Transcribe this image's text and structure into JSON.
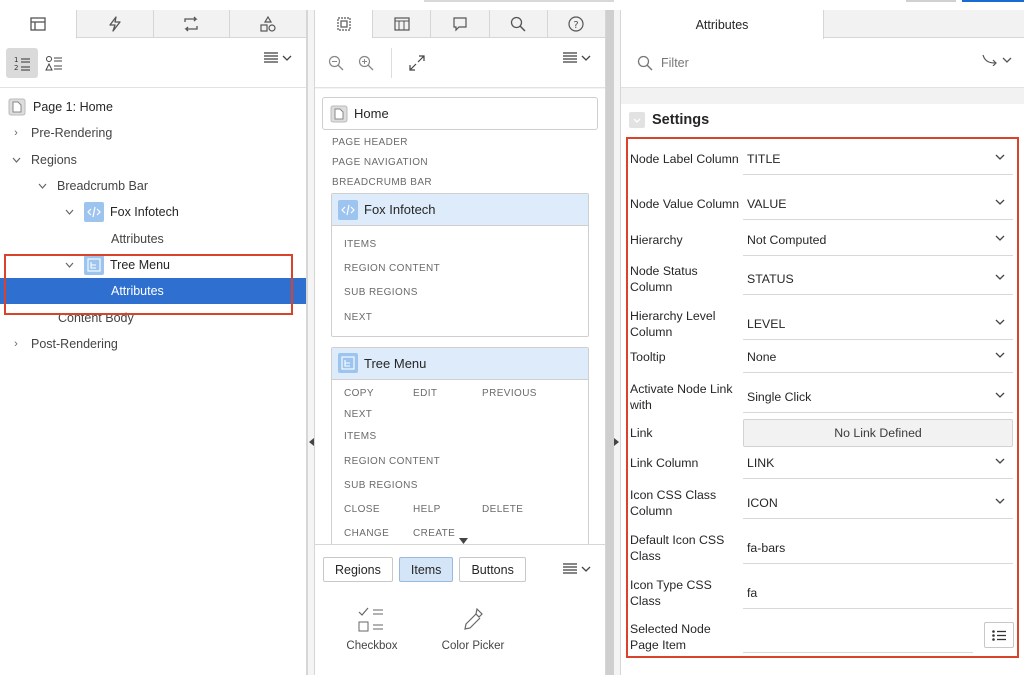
{
  "left": {
    "tree": [
      {
        "label": "Page 1: Home",
        "level": 0,
        "icon": "page-icon"
      },
      {
        "label": "Pre-Rendering",
        "level": 0,
        "expand": "collapsed"
      },
      {
        "label": "Regions",
        "level": 0,
        "expand": "expanded"
      },
      {
        "label": "Breadcrumb Bar",
        "level": 1,
        "expand": "expanded"
      },
      {
        "label": "Fox Infotech",
        "level": 2,
        "expand": "expanded",
        "icon": "code-region-icon"
      },
      {
        "label": "Attributes",
        "level": 3
      },
      {
        "label": "Tree Menu",
        "level": 2,
        "expand": "expanded",
        "icon": "tree-region-icon"
      },
      {
        "label": "Attributes",
        "level": 3,
        "selected": true
      },
      {
        "label": "Content Body",
        "level": 1
      },
      {
        "label": "Post-Rendering",
        "level": 0,
        "expand": "collapsed"
      }
    ]
  },
  "middle": {
    "home_label": "Home",
    "page_sections": [
      "PAGE HEADER",
      "PAGE NAVIGATION",
      "BREADCRUMB BAR"
    ],
    "region1": {
      "title": "Fox Infotech",
      "items": [
        "ITEMS",
        "REGION CONTENT",
        "SUB REGIONS",
        "NEXT"
      ]
    },
    "region2": {
      "title": "Tree Menu",
      "row1": [
        "COPY",
        "EDIT",
        "PREVIOUS"
      ],
      "items": [
        "NEXT",
        "ITEMS",
        "REGION CONTENT",
        "SUB REGIONS"
      ],
      "row2": [
        "CLOSE",
        "HELP",
        "DELETE"
      ],
      "row3": [
        "CHANGE",
        "CREATE"
      ]
    },
    "gallery_tabs": [
      "Regions",
      "Items",
      "Buttons"
    ],
    "gallery_selected": "Items",
    "gallery_items": [
      "Checkbox",
      "Color Picker"
    ]
  },
  "right": {
    "tab": "Attributes",
    "filter_placeholder": "Filter",
    "section": "Settings",
    "props": [
      {
        "label": "Node Label Column",
        "value": "TITLE",
        "type": "select"
      },
      {
        "label": "Node Value Column",
        "value": "VALUE",
        "type": "select"
      },
      {
        "label": "Hierarchy",
        "value": "Not Computed",
        "type": "select"
      },
      {
        "label": "Node Status Column",
        "value": "STATUS",
        "type": "select"
      },
      {
        "label": "Hierarchy Level Column",
        "value": "LEVEL",
        "type": "select"
      },
      {
        "label": "Tooltip",
        "value": "None",
        "type": "select"
      },
      {
        "label": "Activate Node Link with",
        "value": "Single Click",
        "type": "select"
      },
      {
        "label": "Link",
        "value": "No Link Defined",
        "type": "link"
      },
      {
        "label": "Link Column",
        "value": "LINK",
        "type": "select"
      },
      {
        "label": "Icon CSS Class Column",
        "value": "ICON",
        "type": "select"
      },
      {
        "label": "Default Icon CSS Class",
        "value": "fa-bars",
        "type": "text"
      },
      {
        "label": "Icon Type CSS Class",
        "value": "fa",
        "type": "text"
      },
      {
        "label": "Selected Node Page Item",
        "value": "",
        "type": "popup"
      }
    ]
  },
  "colors": {
    "selected_row": "#2e6fcf",
    "highlight_box": "#d9432b",
    "region_header": "#deebfa"
  }
}
